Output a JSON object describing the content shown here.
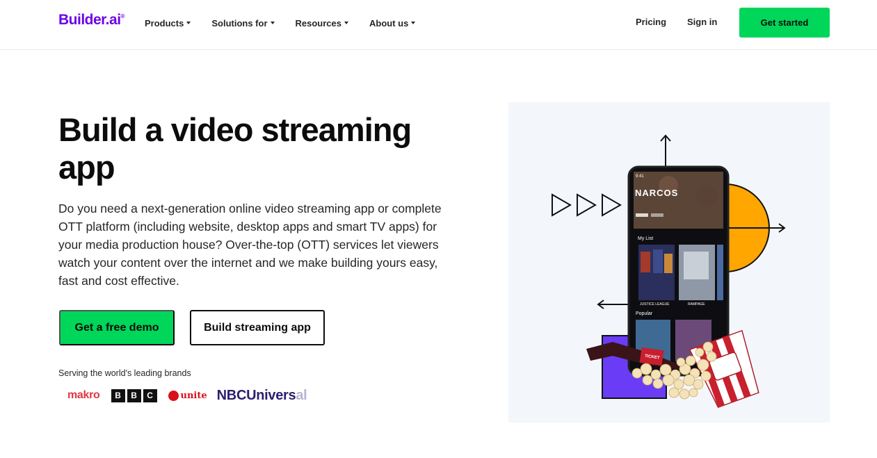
{
  "header": {
    "logo_text": "Builder.ai",
    "logo_mark": "®",
    "nav": [
      {
        "label": "Products"
      },
      {
        "label": "Solutions for"
      },
      {
        "label": "Resources"
      },
      {
        "label": "About us"
      }
    ],
    "pricing_label": "Pricing",
    "signin_label": "Sign in",
    "get_started_label": "Get started"
  },
  "hero": {
    "title": "Build a video streaming app",
    "description": "Do you need a next-generation online video streaming app or complete OTT platform (including website, desktop apps and smart TV apps) for your media production house? Over-the-top (OTT) services let viewers watch your content over the internet and we make building yours easy, fast and cost effective.",
    "demo_button": "Get a free demo",
    "build_button": "Build streaming app",
    "brands_label": "Serving the world's leading brands",
    "brands": {
      "makro": "makro",
      "bbc": [
        "B",
        "B",
        "C"
      ],
      "unite": "unite",
      "nbc_main": "NBCUnivers",
      "nbc_fade": "al"
    }
  },
  "phone": {
    "time": "9:41",
    "feature_title": "NARCOS",
    "my_list_label": "My List",
    "poster_1": "JUSTICE LEAGUE",
    "poster_2": "RAMPAGE",
    "popular_label": "Popular",
    "ticket_text": "TICKET"
  },
  "colors": {
    "brand_purple": "#6c00ea",
    "cta_green": "#00d659",
    "illustration_bg": "#f3f7fb",
    "orange": "#ffa600"
  }
}
